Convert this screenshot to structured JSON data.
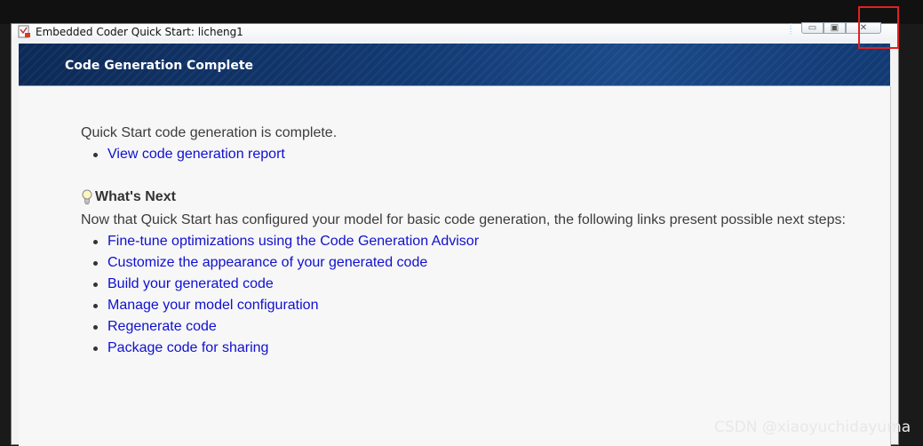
{
  "window": {
    "title": "Embedded Coder Quick Start: licheng1",
    "close_symbol": "✕",
    "minimize_symbol": "▭",
    "maximize_symbol": "▣"
  },
  "banner": {
    "title": "Code Generation Complete"
  },
  "main": {
    "status_text": "Quick Start code generation is complete.",
    "report_link": "View code generation report",
    "whats_next": {
      "heading": "What's Next",
      "intro": "Now that Quick Start has configured your model for basic code generation, the following links present possible next steps:",
      "links": [
        "Fine-tune optimizations using the Code Generation Advisor",
        "Customize the appearance of your generated code",
        "Build your generated code",
        "Manage your model configuration",
        "Regenerate code",
        "Package code for sharing"
      ]
    }
  },
  "watermark": "CSDN @xiaoyuchidayuma",
  "colors": {
    "link": "#1010d0",
    "banner": "#123a73",
    "highlight": "#e02020"
  }
}
